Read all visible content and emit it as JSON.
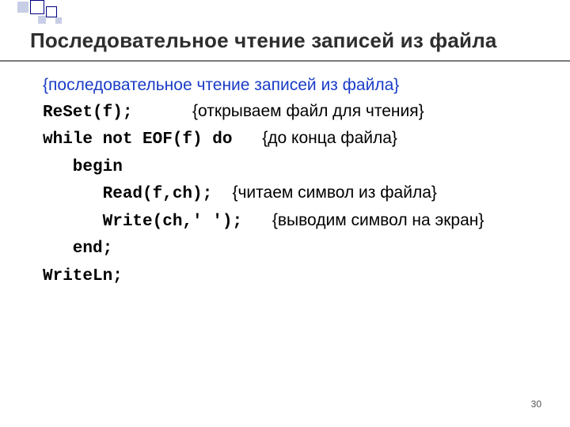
{
  "title": "Последовательное чтение записей из файла",
  "intro_comment": "{последовательное чтение записей из файла}",
  "lines": {
    "l1_code": "ReSet(f);",
    "l1_gap": "      ",
    "l1_cmt": "{открываем файл для чтения}",
    "l2_code": "while not EOF(f) do",
    "l2_gap": "   ",
    "l2_cmt": "{до конца файла}",
    "l3_code": "   begin",
    "l4_code": "      Read(f,ch);",
    "l4_gap": "  ",
    "l4_cmt": "{читаем символ из файла}",
    "l5_code": "      Write(ch,' ');",
    "l5_gap": "   ",
    "l5_cmt": "{выводим символ на экран}",
    "l6_code": "   end;",
    "l7_code": "WriteLn;"
  },
  "page_number": "30",
  "colors": {
    "motif_fill": "#c7cee6",
    "motif_border": "#000080"
  }
}
